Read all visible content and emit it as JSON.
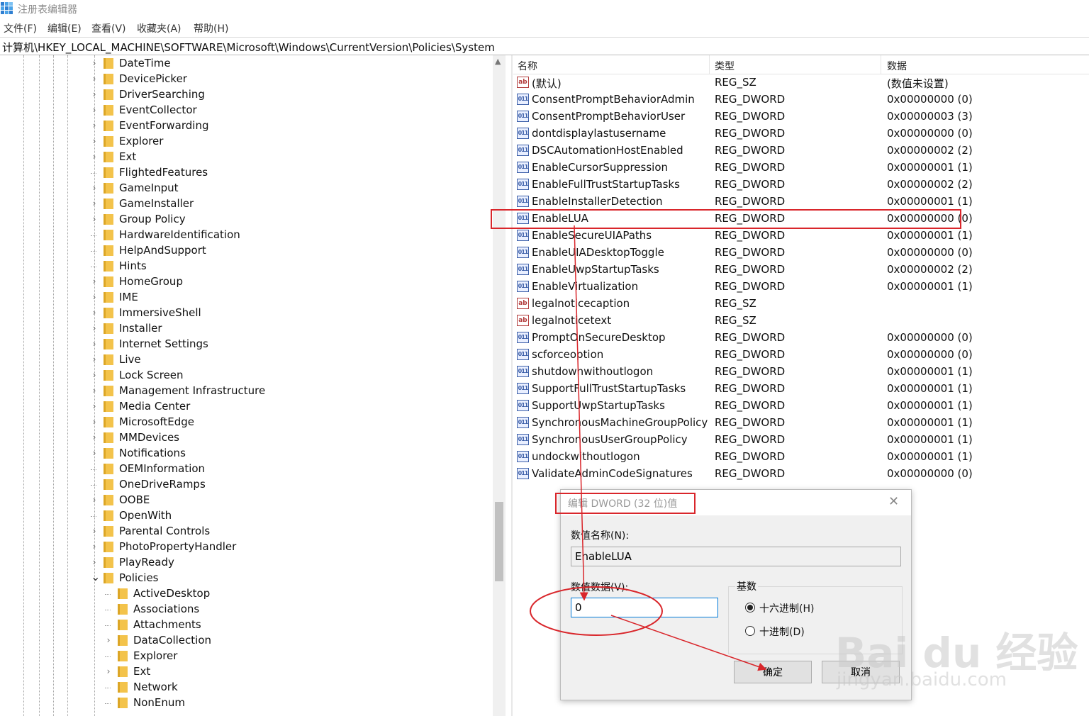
{
  "window": {
    "title": "注册表编辑器"
  },
  "menu": [
    "文件(F)",
    "编辑(E)",
    "查看(V)",
    "收藏夹(A)",
    "帮助(H)"
  ],
  "address": "计算机\\HKEY_LOCAL_MACHINE\\SOFTWARE\\Microsoft\\Windows\\CurrentVersion\\Policies\\System",
  "tree": {
    "items": [
      {
        "label": "DateTime",
        "expandable": true,
        "level": 1
      },
      {
        "label": "DevicePicker",
        "expandable": true,
        "level": 1
      },
      {
        "label": "DriverSearching",
        "expandable": true,
        "level": 1
      },
      {
        "label": "EventCollector",
        "expandable": true,
        "level": 1
      },
      {
        "label": "EventForwarding",
        "expandable": true,
        "level": 1
      },
      {
        "label": "Explorer",
        "expandable": true,
        "level": 1
      },
      {
        "label": "Ext",
        "expandable": true,
        "level": 1
      },
      {
        "label": "FlightedFeatures",
        "expandable": false,
        "level": 1
      },
      {
        "label": "GameInput",
        "expandable": true,
        "level": 1
      },
      {
        "label": "GameInstaller",
        "expandable": true,
        "level": 1
      },
      {
        "label": "Group Policy",
        "expandable": true,
        "level": 1
      },
      {
        "label": "HardwareIdentification",
        "expandable": false,
        "level": 1
      },
      {
        "label": "HelpAndSupport",
        "expandable": false,
        "level": 1
      },
      {
        "label": "Hints",
        "expandable": false,
        "level": 1
      },
      {
        "label": "HomeGroup",
        "expandable": true,
        "level": 1
      },
      {
        "label": "IME",
        "expandable": true,
        "level": 1
      },
      {
        "label": "ImmersiveShell",
        "expandable": true,
        "level": 1
      },
      {
        "label": "Installer",
        "expandable": true,
        "level": 1
      },
      {
        "label": "Internet Settings",
        "expandable": true,
        "level": 1
      },
      {
        "label": "Live",
        "expandable": true,
        "level": 1
      },
      {
        "label": "Lock Screen",
        "expandable": true,
        "level": 1
      },
      {
        "label": "Management Infrastructure",
        "expandable": true,
        "level": 1
      },
      {
        "label": "Media Center",
        "expandable": true,
        "level": 1
      },
      {
        "label": "MicrosoftEdge",
        "expandable": true,
        "level": 1
      },
      {
        "label": "MMDevices",
        "expandable": true,
        "level": 1
      },
      {
        "label": "Notifications",
        "expandable": true,
        "level": 1
      },
      {
        "label": "OEMInformation",
        "expandable": false,
        "level": 1
      },
      {
        "label": "OneDriveRamps",
        "expandable": false,
        "level": 1
      },
      {
        "label": "OOBE",
        "expandable": true,
        "level": 1
      },
      {
        "label": "OpenWith",
        "expandable": false,
        "level": 1
      },
      {
        "label": "Parental Controls",
        "expandable": true,
        "level": 1
      },
      {
        "label": "PhotoPropertyHandler",
        "expandable": true,
        "level": 1
      },
      {
        "label": "PlayReady",
        "expandable": true,
        "level": 1
      },
      {
        "label": "Policies",
        "expandable": true,
        "expanded": true,
        "level": 1
      },
      {
        "label": "ActiveDesktop",
        "expandable": false,
        "level": 2
      },
      {
        "label": "Associations",
        "expandable": false,
        "level": 2
      },
      {
        "label": "Attachments",
        "expandable": false,
        "level": 2
      },
      {
        "label": "DataCollection",
        "expandable": true,
        "level": 2
      },
      {
        "label": "Explorer",
        "expandable": false,
        "level": 2
      },
      {
        "label": "Ext",
        "expandable": true,
        "level": 2
      },
      {
        "label": "Network",
        "expandable": false,
        "level": 2
      },
      {
        "label": "NonEnum",
        "expandable": false,
        "level": 2
      }
    ]
  },
  "list": {
    "headers": {
      "name": "名称",
      "type": "类型",
      "data": "数据"
    },
    "rows": [
      {
        "name": "(默认)",
        "type": "REG_SZ",
        "data": "(数值未设置)",
        "kind": "sz"
      },
      {
        "name": "ConsentPromptBehaviorAdmin",
        "type": "REG_DWORD",
        "data": "0x00000000 (0)",
        "kind": "dword"
      },
      {
        "name": "ConsentPromptBehaviorUser",
        "type": "REG_DWORD",
        "data": "0x00000003 (3)",
        "kind": "dword"
      },
      {
        "name": "dontdisplaylastusername",
        "type": "REG_DWORD",
        "data": "0x00000000 (0)",
        "kind": "dword"
      },
      {
        "name": "DSCAutomationHostEnabled",
        "type": "REG_DWORD",
        "data": "0x00000002 (2)",
        "kind": "dword"
      },
      {
        "name": "EnableCursorSuppression",
        "type": "REG_DWORD",
        "data": "0x00000001 (1)",
        "kind": "dword"
      },
      {
        "name": "EnableFullTrustStartupTasks",
        "type": "REG_DWORD",
        "data": "0x00000002 (2)",
        "kind": "dword"
      },
      {
        "name": "EnableInstallerDetection",
        "type": "REG_DWORD",
        "data": "0x00000001 (1)",
        "kind": "dword"
      },
      {
        "name": "EnableLUA",
        "type": "REG_DWORD",
        "data": "0x00000000 (0)",
        "kind": "dword"
      },
      {
        "name": "EnableSecureUIAPaths",
        "type": "REG_DWORD",
        "data": "0x00000001 (1)",
        "kind": "dword"
      },
      {
        "name": "EnableUIADesktopToggle",
        "type": "REG_DWORD",
        "data": "0x00000000 (0)",
        "kind": "dword"
      },
      {
        "name": "EnableUwpStartupTasks",
        "type": "REG_DWORD",
        "data": "0x00000002 (2)",
        "kind": "dword"
      },
      {
        "name": "EnableVirtualization",
        "type": "REG_DWORD",
        "data": "0x00000001 (1)",
        "kind": "dword"
      },
      {
        "name": "legalnoticecaption",
        "type": "REG_SZ",
        "data": "",
        "kind": "sz"
      },
      {
        "name": "legalnoticetext",
        "type": "REG_SZ",
        "data": "",
        "kind": "sz"
      },
      {
        "name": "PromptOnSecureDesktop",
        "type": "REG_DWORD",
        "data": "0x00000000 (0)",
        "kind": "dword"
      },
      {
        "name": "scforceoption",
        "type": "REG_DWORD",
        "data": "0x00000000 (0)",
        "kind": "dword"
      },
      {
        "name": "shutdownwithoutlogon",
        "type": "REG_DWORD",
        "data": "0x00000001 (1)",
        "kind": "dword"
      },
      {
        "name": "SupportFullTrustStartupTasks",
        "type": "REG_DWORD",
        "data": "0x00000001 (1)",
        "kind": "dword"
      },
      {
        "name": "SupportUwpStartupTasks",
        "type": "REG_DWORD",
        "data": "0x00000001 (1)",
        "kind": "dword"
      },
      {
        "name": "SynchronousMachineGroupPolicy",
        "type": "REG_DWORD",
        "data": "0x00000001 (1)",
        "kind": "dword"
      },
      {
        "name": "SynchronousUserGroupPolicy",
        "type": "REG_DWORD",
        "data": "0x00000001 (1)",
        "kind": "dword"
      },
      {
        "name": "undockwithoutlogon",
        "type": "REG_DWORD",
        "data": "0x00000001 (1)",
        "kind": "dword"
      },
      {
        "name": "ValidateAdminCodeSignatures",
        "type": "REG_DWORD",
        "data": "0x00000000 (0)",
        "kind": "dword"
      }
    ]
  },
  "dialog": {
    "title": "编辑 DWORD (32 位)值",
    "name_label": "数值名称(N):",
    "name_value": "EnableLUA",
    "data_label": "数值数据(V):",
    "data_value": "0",
    "base_label": "基数",
    "radio_hex": "十六进制(H)",
    "radio_dec": "十进制(D)",
    "ok": "确定",
    "cancel": "取消",
    "base_selected": "hex"
  },
  "icons": {
    "value_sz": "ab",
    "value_dword": "011"
  },
  "annotation_color": "#d9262b",
  "watermark": {
    "logo": "Bai du 经验",
    "url": "jingyan.baidu.com"
  }
}
